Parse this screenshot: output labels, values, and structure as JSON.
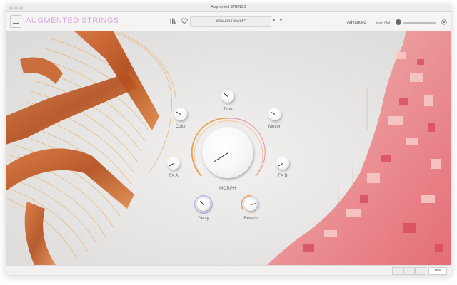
{
  "window": {
    "title": "Augmented STRINGS"
  },
  "toolbar": {
    "brand": "AUGMENTED STRINGS",
    "preset_name": "Beautiful Swell*",
    "advanced_label": "Advanced",
    "main_out_label": "Main Out"
  },
  "icons": {
    "menu": "hamburger-menu-icon",
    "library": "library-books-icon",
    "favorite": "heart-icon",
    "prev": "triangle-up-icon",
    "next": "triangle-down-icon",
    "settings": "gear-icon"
  },
  "macros": [
    {
      "id": "time",
      "label": "Time"
    },
    {
      "id": "color",
      "label": "Color"
    },
    {
      "id": "motion",
      "label": "Motion"
    },
    {
      "id": "fxa",
      "label": "FX A"
    },
    {
      "id": "fxb",
      "label": "FX B"
    },
    {
      "id": "delay",
      "label": "Delay"
    },
    {
      "id": "reverb",
      "label": "Reverb"
    }
  ],
  "morph": {
    "label": "MORPH"
  },
  "statusbar": {
    "zoom": "18%"
  },
  "colors": {
    "brand": "#d7a7e6",
    "morph_ring": "#e8a24f",
    "delay_ring": "#b9b2ee"
  }
}
